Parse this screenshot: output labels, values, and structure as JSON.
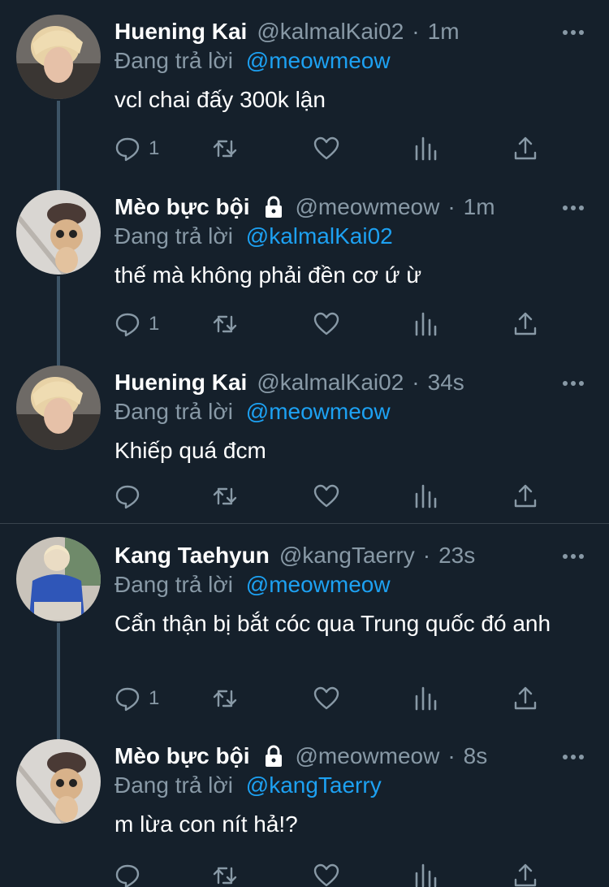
{
  "tweets": [
    {
      "display_name": "Huening Kai",
      "locked": false,
      "handle": "@kalmalKai02",
      "time": "1m",
      "reply_prefix": "Đang trả lời",
      "reply_to": "@meowmeow",
      "text": "vcl chai đấy 300k lận",
      "reply_count": "1",
      "avatar": "huening-kai"
    },
    {
      "display_name": "Mèo bực bội",
      "locked": true,
      "handle": "@meowmeow",
      "time": "1m",
      "reply_prefix": "Đang trả lời",
      "reply_to": "@kalmalKai02",
      "text": "thế mà không phải đền cơ ứ ừ",
      "reply_count": "1",
      "avatar": "cat"
    },
    {
      "display_name": "Huening Kai",
      "locked": false,
      "handle": "@kalmalKai02",
      "time": "34s",
      "reply_prefix": "Đang trả lời",
      "reply_to": "@meowmeow",
      "text": "Khiếp quá đcm",
      "reply_count": "",
      "avatar": "huening-kai"
    },
    {
      "display_name": "Kang Taehyun",
      "locked": false,
      "handle": "@kangTaerry",
      "time": "23s",
      "reply_prefix": "Đang trả lời",
      "reply_to": "@meowmeow",
      "text": "Cẩn thận bị bắt cóc qua Trung quốc đó anh",
      "reply_count": "1",
      "avatar": "kang-taehyun"
    },
    {
      "display_name": "Mèo bực bội",
      "locked": true,
      "handle": "@meowmeow",
      "time": "8s",
      "reply_prefix": "Đang trả lời",
      "reply_to": "@kangTaerry",
      "text": "m lừa con nít hả!?",
      "reply_count": "",
      "avatar": "cat"
    }
  ],
  "separator": "·",
  "colors": {
    "background": "#15202b",
    "secondary_text": "#8899a6",
    "link": "#1da1f2",
    "thread_line": "#3d5466",
    "divider": "#38444d"
  }
}
